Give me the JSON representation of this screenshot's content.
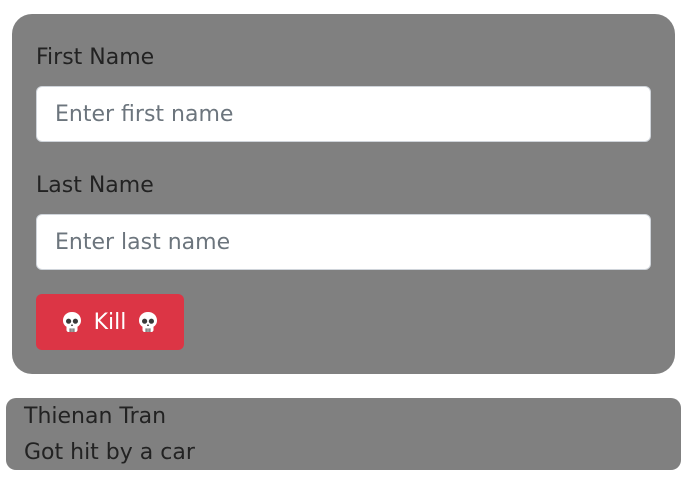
{
  "form": {
    "first_name_label": "First Name",
    "first_name_placeholder": "Enter first name",
    "first_name_value": "",
    "last_name_label": "Last Name",
    "last_name_placeholder": "Enter last name",
    "last_name_value": "",
    "kill_button_label": "Kill",
    "kill_button_icon": "skull-icon",
    "kill_button_color": "#dc3545",
    "card_color": "#808080"
  },
  "result": {
    "name": "Thienan Tran",
    "cause": "Got hit by a car"
  }
}
